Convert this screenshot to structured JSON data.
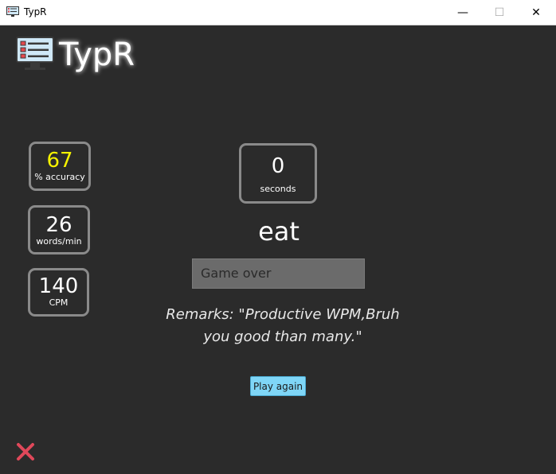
{
  "window": {
    "title": "TypR",
    "minimize_glyph": "—",
    "maximize_glyph": "☐",
    "close_glyph": "✕"
  },
  "app": {
    "name": "TypR"
  },
  "stats": {
    "accuracy": {
      "value": "67",
      "label": "% accuracy",
      "color": "#f5f200"
    },
    "wpm": {
      "value": "26",
      "label": "words/min"
    },
    "cpm": {
      "value": "140",
      "label": "CPM"
    },
    "timer": {
      "value": "0",
      "label": "seconds"
    }
  },
  "current_word": "eat",
  "input": {
    "value": "Game over"
  },
  "remarks": "Remarks: \"Productive WPM,Bruh you good than many.\"",
  "play_again_label": "Play again",
  "colors": {
    "background": "#2b2b2b",
    "accent": "#7fd6f7",
    "exit": "#e0485a"
  },
  "icons": {
    "app": "monitor-checklist-icon",
    "exit": "close-x-icon"
  }
}
